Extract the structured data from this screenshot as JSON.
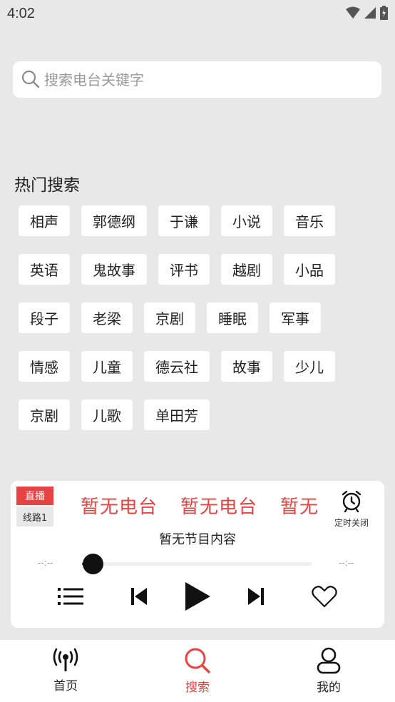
{
  "status_bar": {
    "time": "4:02"
  },
  "search": {
    "placeholder": "搜索电台关键字",
    "value": ""
  },
  "hot_search": {
    "title": "热门搜索",
    "rows": [
      [
        "相声",
        "郭德纲",
        "于谦",
        "小说",
        "音乐"
      ],
      [
        "英语",
        "鬼故事",
        "评书",
        "越剧",
        "小品"
      ],
      [
        "段子",
        "老梁",
        "京剧",
        "睡眠",
        "军事"
      ],
      [
        "情感",
        "儿童",
        "德云社",
        "故事",
        "少儿"
      ],
      [
        "京剧",
        "儿歌",
        "单田芳"
      ]
    ]
  },
  "player": {
    "live_badge": "直播",
    "line_badge": "线路1",
    "station_marquee": [
      "暂无电台",
      "暂无电台",
      "暂无电台"
    ],
    "timer_label": "定时关闭",
    "program": "暂无节目内容",
    "time_current": "--:--",
    "time_total": "--:--",
    "progress": 0.05
  },
  "tabbar": {
    "tabs": [
      {
        "label": "首页",
        "icon": "radio-antenna-icon",
        "active": false
      },
      {
        "label": "搜索",
        "icon": "search-icon",
        "active": true
      },
      {
        "label": "我的",
        "icon": "user-icon",
        "active": false
      }
    ],
    "active_color": "#e94242",
    "inactive_color": "#222222"
  },
  "colors": {
    "accent": "#e94242",
    "background": "#e8e8e8"
  }
}
